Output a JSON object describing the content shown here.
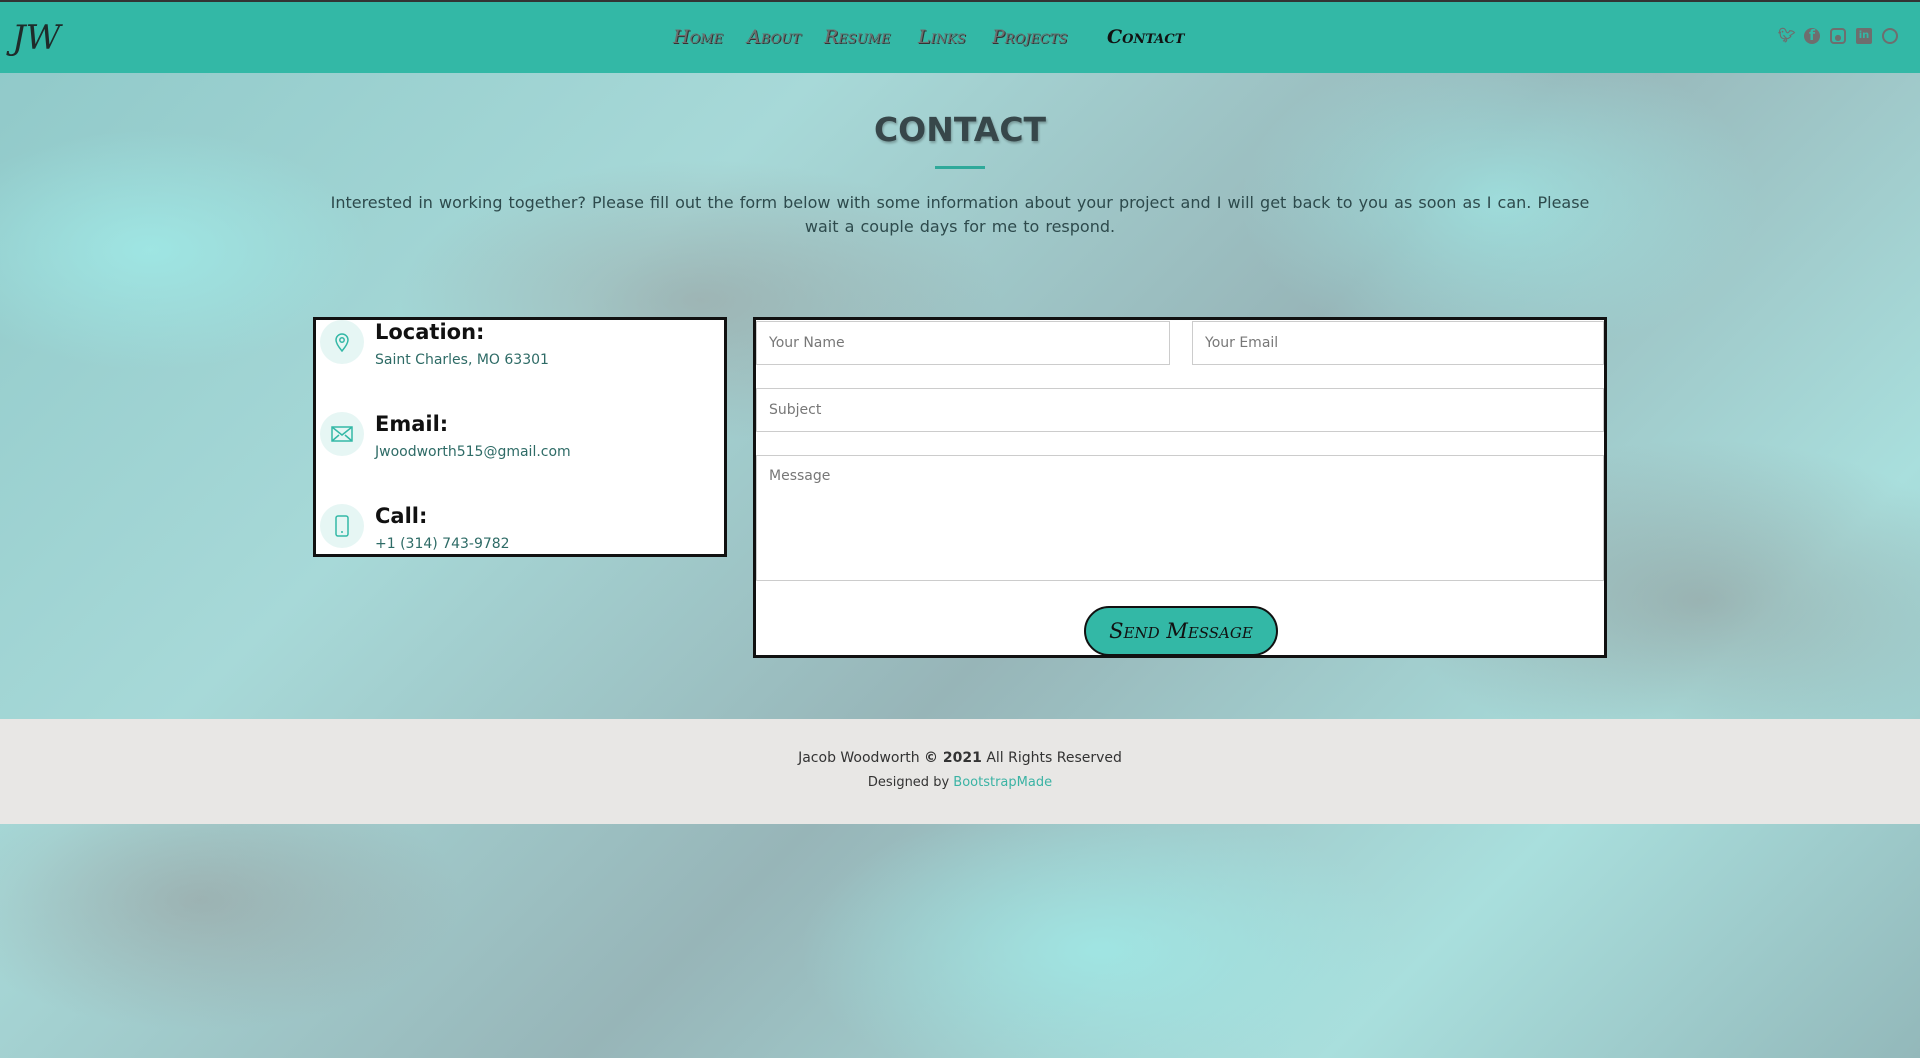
{
  "header": {
    "logo": "JW",
    "nav": [
      {
        "label": "Home"
      },
      {
        "label": "About"
      },
      {
        "label": "Resume"
      },
      {
        "label": "Links"
      },
      {
        "label": "Projects"
      },
      {
        "label": "Contact",
        "active": true
      }
    ],
    "social": [
      "twitter-icon",
      "facebook-icon",
      "instagram-icon",
      "linkedin-icon",
      "github-icon"
    ]
  },
  "section": {
    "title": "CONTACT",
    "intro": "Interested in working together?   Please fill out the form below with some information about your project and I will get back to you as soon as I can.   Please wait a couple days for me to respond."
  },
  "info": [
    {
      "label": "Location:",
      "value": "Saint Charles, MO 63301",
      "icon": "map-pin-icon"
    },
    {
      "label": "Email:",
      "value": "Jwoodworth515@gmail.com",
      "icon": "envelope-icon"
    },
    {
      "label": "Call:",
      "value": "+1 (314) 743-9782",
      "icon": "phone-icon"
    }
  ],
  "form": {
    "name_placeholder": "Your Name",
    "email_placeholder": "Your Email",
    "subject_placeholder": "Subject",
    "message_placeholder": "Message",
    "submit": "Send Message"
  },
  "footer": {
    "name": "Jacob Woodworth",
    "copy": "© 2021",
    "rights": "All Rights Reserved",
    "designed_by": "Designed by",
    "designer": "BootstrapMade"
  },
  "colors": {
    "accent": "#33b8a6",
    "footer_bg": "#e8e7e5"
  }
}
